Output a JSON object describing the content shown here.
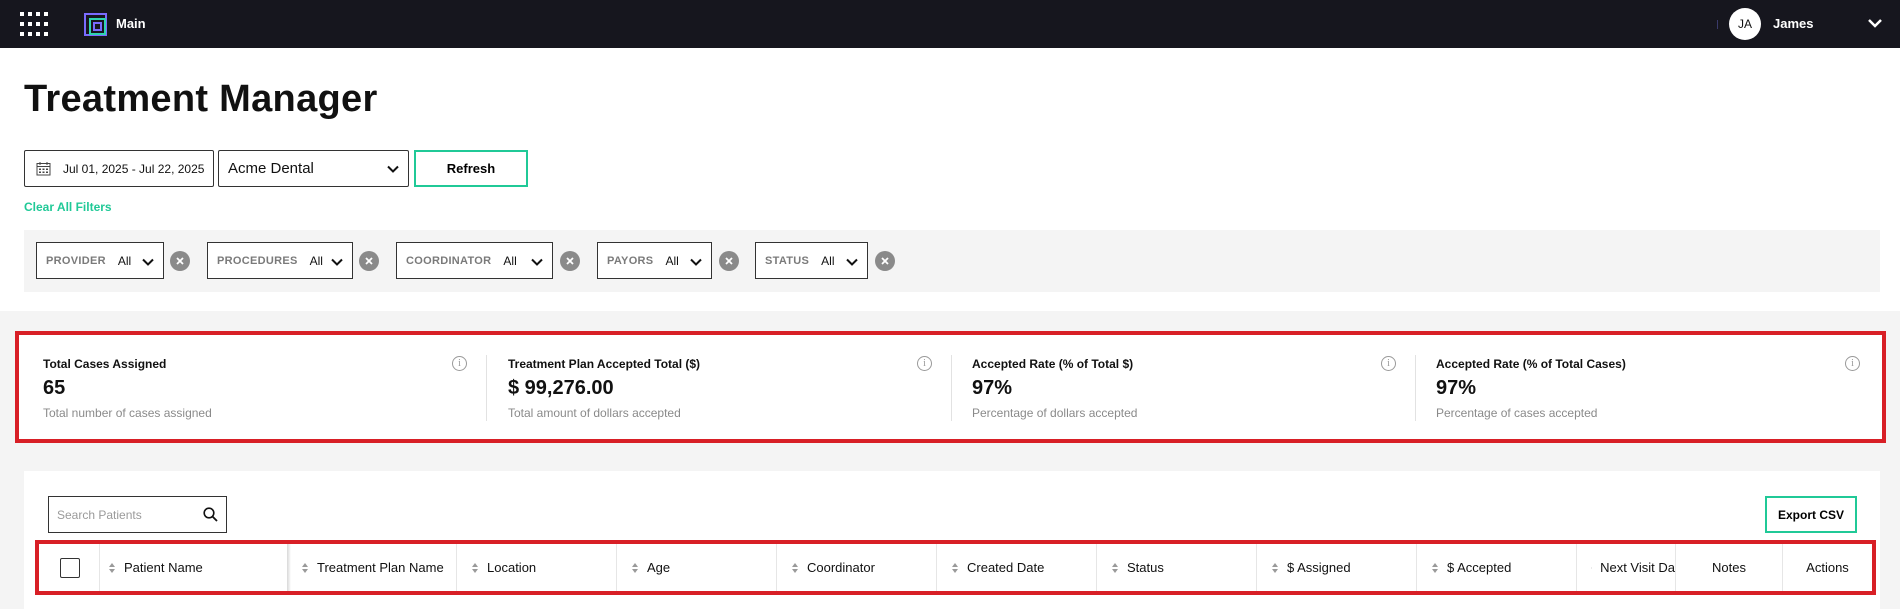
{
  "topbar": {
    "app_title": "Main",
    "user_initials": "JA",
    "user_name": "James",
    "icons": [
      "apps-grid-icon",
      "app-logo-icon",
      "chevron-down-icon"
    ]
  },
  "page": {
    "title": "Treatment Manager"
  },
  "controls": {
    "date_range": "Jul 01, 2025 - Jul 22, 2025",
    "location": "Acme Dental",
    "refresh_label": "Refresh",
    "clear_filters_label": "Clear All Filters"
  },
  "filters": [
    {
      "label": "PROVIDER",
      "value": "All"
    },
    {
      "label": "PROCEDURES",
      "value": "All"
    },
    {
      "label": "COORDINATOR",
      "value": "All"
    },
    {
      "label": "PAYORS",
      "value": "All"
    },
    {
      "label": "STATUS",
      "value": "All"
    }
  ],
  "stats": [
    {
      "title": "Total Cases Assigned",
      "value": "65",
      "desc": "Total number of cases assigned"
    },
    {
      "title": "Treatment Plan Accepted Total ($)",
      "value": "$ 99,276.00",
      "desc": "Total amount of dollars accepted"
    },
    {
      "title": "Accepted Rate (% of Total $)",
      "value": "97%",
      "desc": "Percentage of dollars accepted"
    },
    {
      "title": "Accepted Rate (% of Total Cases)",
      "value": "97%",
      "desc": "Percentage of cases accepted"
    }
  ],
  "table": {
    "search_placeholder": "Search Patients",
    "export_label": "Export CSV",
    "columns": [
      "Patient Name",
      "Treatment Plan Name",
      "Location",
      "Age",
      "Coordinator",
      "Created Date",
      "Status",
      "$ Assigned",
      "$ Accepted",
      "Next Visit Da",
      "Notes",
      "Actions"
    ]
  },
  "colors": {
    "accent": "#20c997",
    "highlight_border": "#d81f26",
    "topbar_bg": "#16161e"
  }
}
